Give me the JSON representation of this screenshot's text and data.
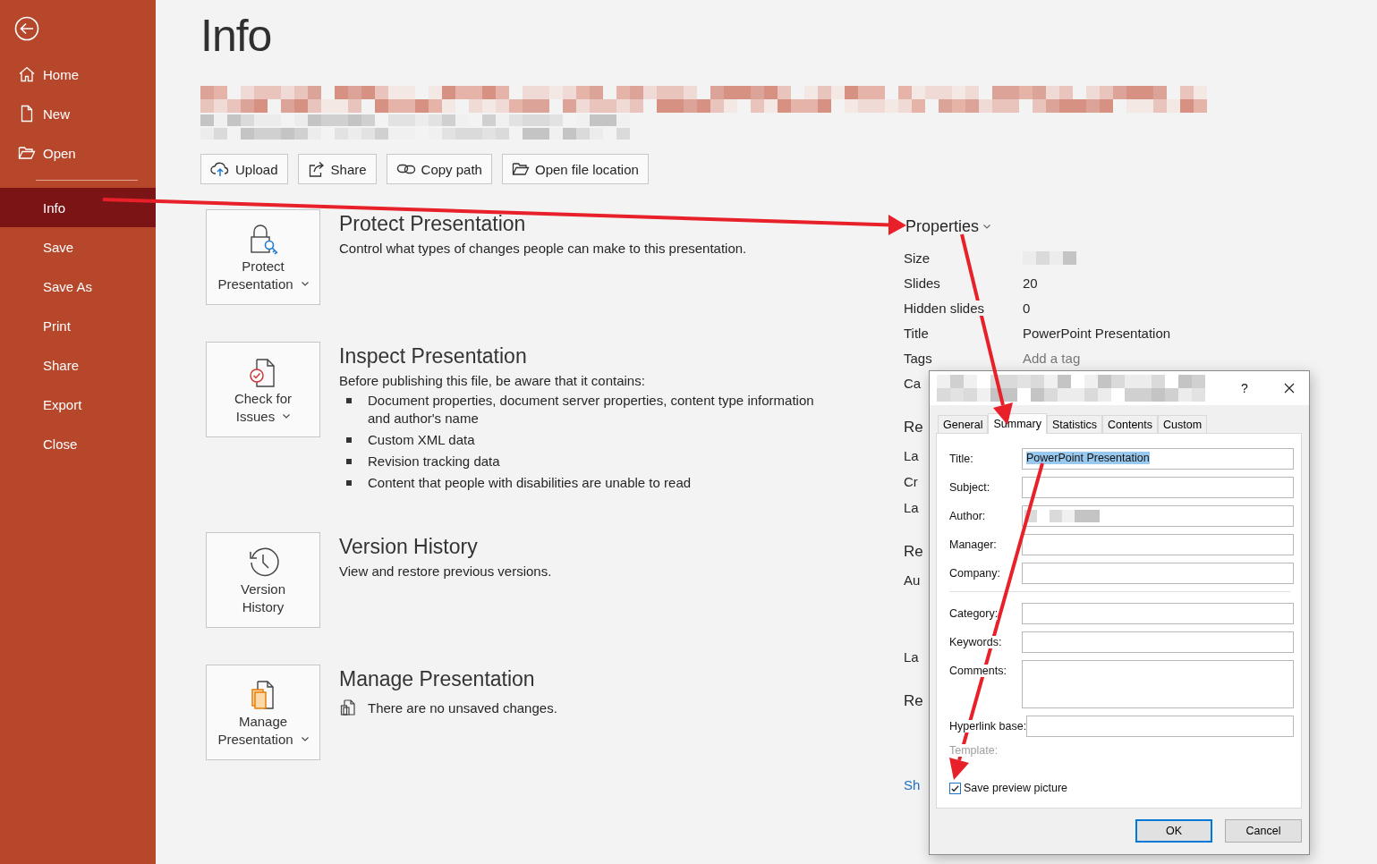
{
  "sidebar": {
    "items": [
      {
        "label": "Home",
        "kind": "icon",
        "selected": false
      },
      {
        "label": "New",
        "kind": "icon",
        "selected": false
      },
      {
        "label": "Open",
        "kind": "icon",
        "selected": false
      },
      {
        "label": "Info",
        "kind": "plain",
        "selected": true
      },
      {
        "label": "Save",
        "kind": "plain",
        "selected": false
      },
      {
        "label": "Save As",
        "kind": "plain",
        "selected": false
      },
      {
        "label": "Print",
        "kind": "plain",
        "selected": false
      },
      {
        "label": "Share",
        "kind": "plain",
        "selected": false
      },
      {
        "label": "Export",
        "kind": "plain",
        "selected": false
      },
      {
        "label": "Close",
        "kind": "plain",
        "selected": false
      }
    ]
  },
  "page_title": "Info",
  "file_location": {
    "kind": "redacted"
  },
  "actions": [
    "Upload",
    "Share",
    "Copy path",
    "Open file location"
  ],
  "sections": [
    {
      "button": [
        "Protect",
        "Presentation"
      ],
      "dropdown": true,
      "title": "Protect Presentation",
      "description": "Control what types of changes people can make to this presentation."
    },
    {
      "button": [
        "Check for",
        "Issues"
      ],
      "dropdown": true,
      "title": "Inspect Presentation",
      "description": "Before publishing this file, be aware that it contains:",
      "bullets": [
        "Document properties, document server properties, content type information and author's name",
        "Custom XML data",
        "Revision tracking data",
        "Content that people with disabilities are unable to read"
      ]
    },
    {
      "button": [
        "Version",
        "History"
      ],
      "dropdown": false,
      "title": "Version History",
      "description": "View and restore previous versions."
    },
    {
      "button": [
        "Manage",
        "Presentation"
      ],
      "dropdown": true,
      "title": "Manage Presentation",
      "note": "There are no unsaved changes."
    }
  ],
  "properties": {
    "heading": "Properties",
    "rows": [
      {
        "label": "Size",
        "kind": "redacted"
      },
      {
        "label": "Slides",
        "kind": "text",
        "value": "20"
      },
      {
        "label": "Hidden slides",
        "kind": "text",
        "value": "0"
      },
      {
        "label": "Title",
        "kind": "text",
        "value": "PowerPoint Presentation"
      },
      {
        "label": "Tags",
        "kind": "placeholder",
        "placeholder": "Add a tag"
      }
    ],
    "more": [
      {
        "kind": "label",
        "text": "Ca"
      },
      {
        "kind": "heading",
        "text": "Re"
      },
      {
        "kind": "label",
        "text": "La"
      },
      {
        "kind": "label",
        "text": "Cr"
      },
      {
        "kind": "label",
        "text": "La"
      },
      {
        "kind": "heading",
        "text": "Re"
      },
      {
        "kind": "person",
        "text": "Au"
      },
      {
        "kind": "label",
        "text": "La"
      },
      {
        "kind": "heading",
        "text": "Re"
      },
      {
        "kind": "link",
        "text": "Sh"
      }
    ]
  },
  "dialog": {
    "title": {
      "kind": "redacted"
    },
    "help": "?",
    "tabs": [
      {
        "label": "General",
        "selected": false
      },
      {
        "label": "Summary",
        "selected": true
      },
      {
        "label": "Statistics",
        "selected": false
      },
      {
        "label": "Contents",
        "selected": false
      },
      {
        "label": "Custom",
        "selected": false
      }
    ],
    "fields": [
      {
        "label": "Title:",
        "kind": "line",
        "value": "PowerPoint Presentation",
        "selected": true
      },
      {
        "label": "Subject:",
        "kind": "line"
      },
      {
        "label": "Author:",
        "kind": "line",
        "redacted": true
      },
      {
        "label": "Manager:",
        "kind": "line"
      },
      {
        "label": "Company:",
        "kind": "line"
      },
      {
        "kind": "separator"
      },
      {
        "label": "Category:",
        "kind": "line"
      },
      {
        "label": "Keywords:",
        "kind": "line"
      },
      {
        "label": "Comments:",
        "kind": "area"
      },
      {
        "label": "Hyperlink base:",
        "kind": "line"
      },
      {
        "label": "Template:",
        "kind": "static",
        "disabled": true
      }
    ],
    "checkbox": {
      "label": "Save preview picture",
      "checked": true
    },
    "buttons": [
      {
        "label": "OK",
        "default": true
      },
      {
        "label": "Cancel",
        "default": false
      }
    ]
  }
}
